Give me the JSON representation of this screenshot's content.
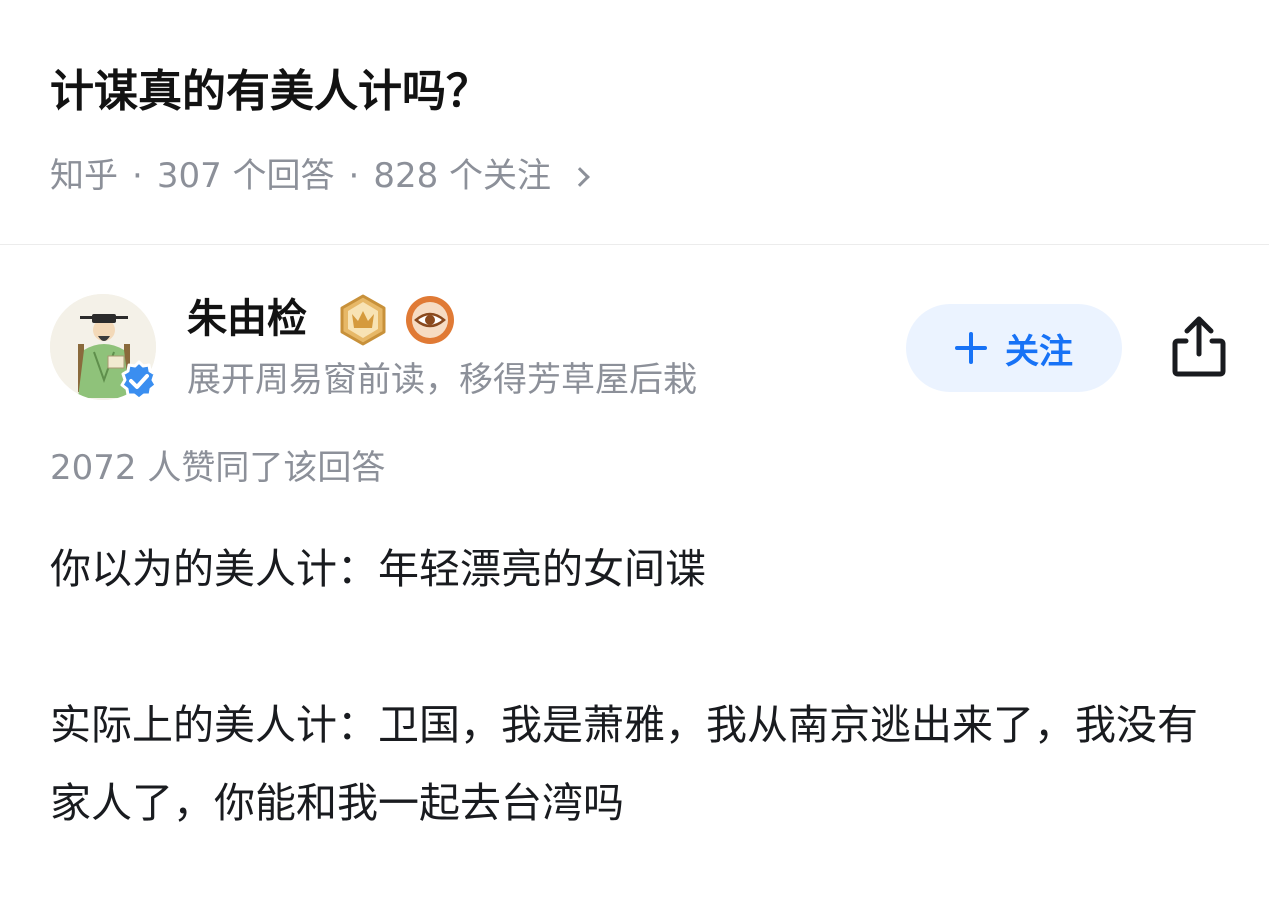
{
  "question": {
    "title": "计谋真的有美人计吗？",
    "source": "知乎",
    "answers": "307 个回答",
    "followers": "828 个关注"
  },
  "author": {
    "name": "朱由检",
    "bio": "展开周易窗前读，移得芳草屋后栽",
    "badges": [
      "crown-badge",
      "eye-badge"
    ],
    "verified": true
  },
  "actions": {
    "follow_label": "关注"
  },
  "answer": {
    "vote_text": "2072 人赞同了该回答",
    "paragraphs": [
      "你以为的美人计：年轻漂亮的女间谍",
      "实际上的美人计：卫国，我是萧雅，我从南京逃出来了，我没有家人了，你能和我一起去台湾吗"
    ]
  },
  "colors": {
    "accent": "#1772f6",
    "follow_bg": "#ebf3ff",
    "meta_text": "#8c9099",
    "badge_gold": "#d8a34a",
    "badge_orange": "#e07a35"
  }
}
